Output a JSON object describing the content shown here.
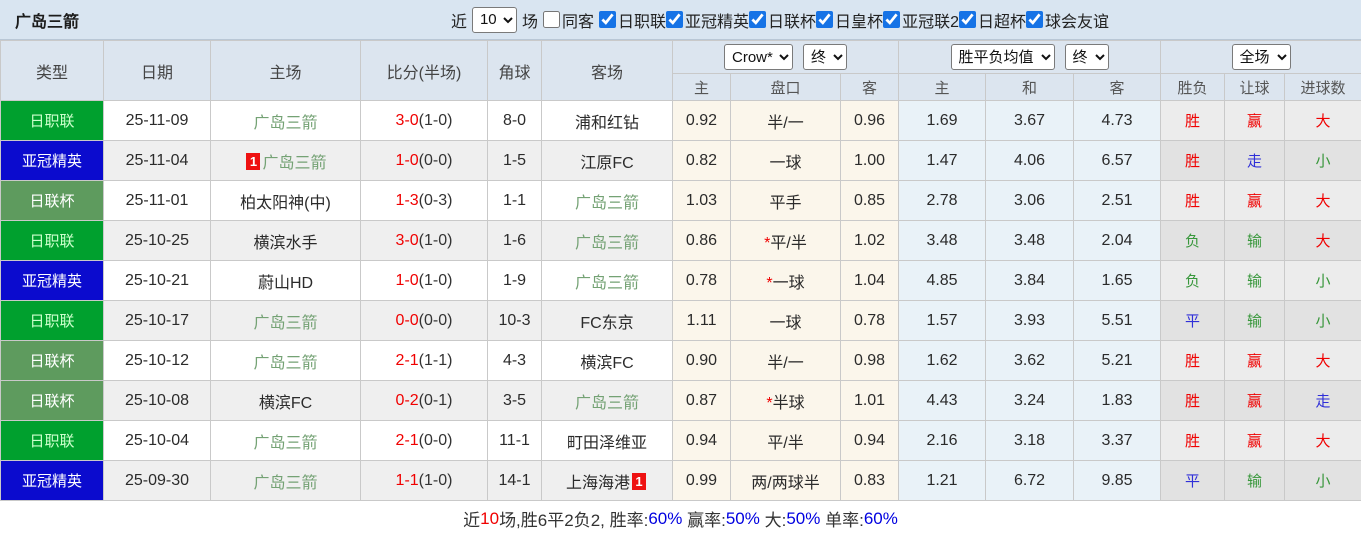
{
  "topbar": {
    "title": "广岛三箭",
    "near_label": "近",
    "near_value": "10",
    "games_label": "场",
    "same_away_label": "同客",
    "same_away_checked": false,
    "leagues": [
      "日职联",
      "亚冠精英",
      "日联杯",
      "日皇杯",
      "亚冠联2",
      "日超杯",
      "球会友谊"
    ]
  },
  "header": {
    "type": "类型",
    "date": "日期",
    "home": "主场",
    "score": "比分(半场)",
    "corner": "角球",
    "away": "客场",
    "handicap_company_select": "Crow*",
    "handicap_time_select": "终",
    "odds_company_select": "胜平负均值",
    "odds_time_select": "终",
    "scope_select": "全场",
    "sub": [
      "主",
      "盘口",
      "客",
      "主",
      "和",
      "客",
      "胜负",
      "让球",
      "进球数"
    ]
  },
  "league_styles": {
    "日职联": {
      "bg": "#00A02E",
      "fg": "#CCFFCC"
    },
    "亚冠精英": {
      "bg": "#0B0BCE",
      "fg": "#FFFFFF"
    },
    "日联杯": {
      "bg": "#5E9B5E",
      "fg": "#FFFFFF"
    }
  },
  "colors": {
    "accent_checkbox": "#1673E6",
    "score_red": "#F00000",
    "team_self_green": "#74A274",
    "result_red": "#F00000",
    "result_green": "#38973B",
    "result_blue": "#2F2FD8",
    "footer_blue": "#0000E0"
  },
  "rows": [
    {
      "type": "日职联",
      "date": "25-11-09",
      "home": "广岛三箭",
      "home_self": true,
      "home_badge": "",
      "score": "3-0",
      "half": "(1-0)",
      "corner": "8-0",
      "away": "浦和红钻",
      "away_self": false,
      "away_badge": "",
      "h_home": "0.92",
      "handicap": "半/一",
      "handicap_star": false,
      "h_away": "0.96",
      "o_home": "1.69",
      "o_draw": "3.67",
      "o_away": "4.73",
      "wl": "胜",
      "wl_c": "red",
      "hc": "赢",
      "hc_c": "red",
      "goals": "大",
      "goals_c": "red"
    },
    {
      "type": "亚冠精英",
      "date": "25-11-04",
      "home": "广岛三箭",
      "home_self": true,
      "home_badge": "1",
      "score": "1-0",
      "half": "(0-0)",
      "corner": "1-5",
      "away": "江原FC",
      "away_self": false,
      "away_badge": "",
      "h_home": "0.82",
      "handicap": "一球",
      "handicap_star": false,
      "h_away": "1.00",
      "o_home": "1.47",
      "o_draw": "4.06",
      "o_away": "6.57",
      "wl": "胜",
      "wl_c": "red",
      "hc": "走",
      "hc_c": "blue",
      "goals": "小",
      "goals_c": "green"
    },
    {
      "type": "日联杯",
      "date": "25-11-01",
      "home": "柏太阳神(中)",
      "home_self": false,
      "home_badge": "",
      "score": "1-3",
      "half": "(0-3)",
      "corner": "1-1",
      "away": "广岛三箭",
      "away_self": true,
      "away_badge": "",
      "h_home": "1.03",
      "handicap": "平手",
      "handicap_star": false,
      "h_away": "0.85",
      "o_home": "2.78",
      "o_draw": "3.06",
      "o_away": "2.51",
      "wl": "胜",
      "wl_c": "red",
      "hc": "赢",
      "hc_c": "red",
      "goals": "大",
      "goals_c": "red"
    },
    {
      "type": "日职联",
      "date": "25-10-25",
      "home": "横滨水手",
      "home_self": false,
      "home_badge": "",
      "score": "3-0",
      "half": "(1-0)",
      "corner": "1-6",
      "away": "广岛三箭",
      "away_self": true,
      "away_badge": "",
      "h_home": "0.86",
      "handicap": "平/半",
      "handicap_star": true,
      "h_away": "1.02",
      "o_home": "3.48",
      "o_draw": "3.48",
      "o_away": "2.04",
      "wl": "负",
      "wl_c": "green",
      "hc": "输",
      "hc_c": "green",
      "goals": "大",
      "goals_c": "red"
    },
    {
      "type": "亚冠精英",
      "date": "25-10-21",
      "home": "蔚山HD",
      "home_self": false,
      "home_badge": "",
      "score": "1-0",
      "half": "(1-0)",
      "corner": "1-9",
      "away": "广岛三箭",
      "away_self": true,
      "away_badge": "",
      "h_home": "0.78",
      "handicap": "一球",
      "handicap_star": true,
      "h_away": "1.04",
      "o_home": "4.85",
      "o_draw": "3.84",
      "o_away": "1.65",
      "wl": "负",
      "wl_c": "green",
      "hc": "输",
      "hc_c": "green",
      "goals": "小",
      "goals_c": "green"
    },
    {
      "type": "日职联",
      "date": "25-10-17",
      "home": "广岛三箭",
      "home_self": true,
      "home_badge": "",
      "score": "0-0",
      "half": "(0-0)",
      "corner": "10-3",
      "away": "FC东京",
      "away_self": false,
      "away_badge": "",
      "h_home": "1.11",
      "handicap": "一球",
      "handicap_star": false,
      "h_away": "0.78",
      "o_home": "1.57",
      "o_draw": "3.93",
      "o_away": "5.51",
      "wl": "平",
      "wl_c": "blue",
      "hc": "输",
      "hc_c": "green",
      "goals": "小",
      "goals_c": "green"
    },
    {
      "type": "日联杯",
      "date": "25-10-12",
      "home": "广岛三箭",
      "home_self": true,
      "home_badge": "",
      "score": "2-1",
      "half": "(1-1)",
      "corner": "4-3",
      "away": "横滨FC",
      "away_self": false,
      "away_badge": "",
      "h_home": "0.90",
      "handicap": "半/一",
      "handicap_star": false,
      "h_away": "0.98",
      "o_home": "1.62",
      "o_draw": "3.62",
      "o_away": "5.21",
      "wl": "胜",
      "wl_c": "red",
      "hc": "赢",
      "hc_c": "red",
      "goals": "大",
      "goals_c": "red"
    },
    {
      "type": "日联杯",
      "date": "25-10-08",
      "home": "横滨FC",
      "home_self": false,
      "home_badge": "",
      "score": "0-2",
      "half": "(0-1)",
      "corner": "3-5",
      "away": "广岛三箭",
      "away_self": true,
      "away_badge": "",
      "h_home": "0.87",
      "handicap": "半球",
      "handicap_star": true,
      "h_away": "1.01",
      "o_home": "4.43",
      "o_draw": "3.24",
      "o_away": "1.83",
      "wl": "胜",
      "wl_c": "red",
      "hc": "赢",
      "hc_c": "red",
      "goals": "走",
      "goals_c": "blue"
    },
    {
      "type": "日职联",
      "date": "25-10-04",
      "home": "广岛三箭",
      "home_self": true,
      "home_badge": "",
      "score": "2-1",
      "half": "(0-0)",
      "corner": "11-1",
      "away": "町田泽维亚",
      "away_self": false,
      "away_badge": "",
      "h_home": "0.94",
      "handicap": "平/半",
      "handicap_star": false,
      "h_away": "0.94",
      "o_home": "2.16",
      "o_draw": "3.18",
      "o_away": "3.37",
      "wl": "胜",
      "wl_c": "red",
      "hc": "赢",
      "hc_c": "red",
      "goals": "大",
      "goals_c": "red"
    },
    {
      "type": "亚冠精英",
      "date": "25-09-30",
      "home": "广岛三箭",
      "home_self": true,
      "home_badge": "",
      "score": "1-1",
      "half": "(1-0)",
      "corner": "14-1",
      "away": "上海海港",
      "away_self": false,
      "away_badge": "1",
      "h_home": "0.99",
      "handicap": "两/两球半",
      "handicap_star": false,
      "h_away": "0.83",
      "o_home": "1.21",
      "o_draw": "6.72",
      "o_away": "9.85",
      "wl": "平",
      "wl_c": "blue",
      "hc": "输",
      "hc_c": "green",
      "goals": "小",
      "goals_c": "green"
    }
  ],
  "footer": {
    "prefix": "近",
    "count": "10",
    "mid": "场,胜6平2负2, 胜率:",
    "rate1": "60%",
    "seg2": " 赢率:",
    "rate2": "50%",
    "seg3": " 大:",
    "rate3": "50%",
    "seg4": " 单率:",
    "rate4": "60%"
  }
}
